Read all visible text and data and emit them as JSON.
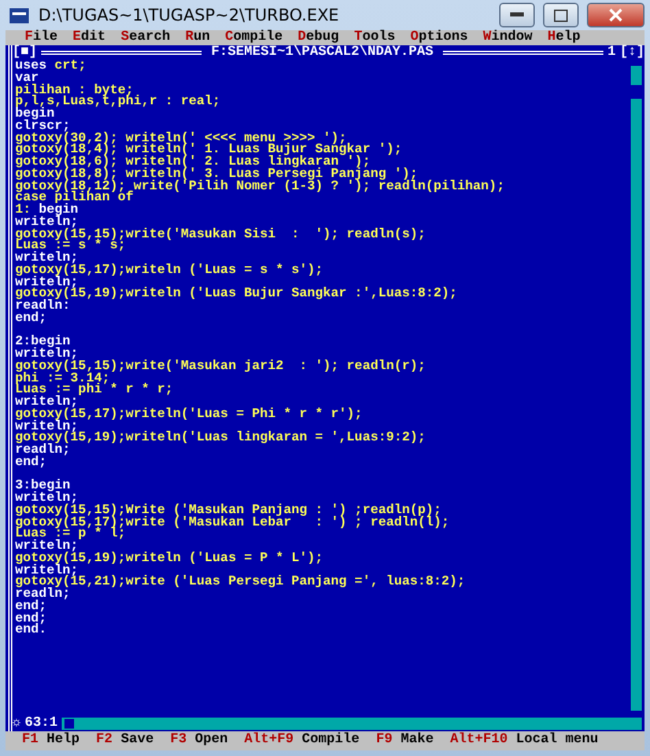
{
  "window": {
    "title": "D:\\TUGAS~1\\TUGASP~2\\TURBO.EXE"
  },
  "menu": [
    {
      "label": "File"
    },
    {
      "label": "Edit"
    },
    {
      "label": "Search"
    },
    {
      "label": "Run"
    },
    {
      "label": "Compile"
    },
    {
      "label": "Debug"
    },
    {
      "label": "Tools"
    },
    {
      "label": "Options"
    },
    {
      "label": "Window"
    },
    {
      "label": "Help"
    }
  ],
  "editor": {
    "close_box": "[■]",
    "file_path": "F:SEMESI~1\\PASCAL2\\NDAY.PAS",
    "window_number": "1",
    "zoom_box": "[↕]",
    "modified_mark": "☼",
    "cursor_position": "63:1",
    "lines": [
      {
        "parts": [
          {
            "text": "uses ",
            "kind": "keyword"
          },
          {
            "text": "crt;",
            "kind": "plain"
          }
        ]
      },
      {
        "parts": [
          {
            "text": "var",
            "kind": "keyword"
          }
        ]
      },
      {
        "parts": [
          {
            "text": "pilihan : byte;",
            "kind": "plain"
          }
        ]
      },
      {
        "parts": [
          {
            "text": "p,l,s,Luas,t,phi,r : real;",
            "kind": "plain"
          }
        ]
      },
      {
        "parts": [
          {
            "text": "begin",
            "kind": "keyword"
          }
        ]
      },
      {
        "parts": [
          {
            "text": "clrscr;",
            "kind": "keyword"
          }
        ]
      },
      {
        "parts": [
          {
            "text": "gotoxy(30,2); writeln(' <<<< menu >>>> ');",
            "kind": "plain"
          }
        ]
      },
      {
        "parts": [
          {
            "text": "gotoxy(18,4); writeln(' 1. Luas Bujur Sangkar ');",
            "kind": "plain"
          }
        ]
      },
      {
        "parts": [
          {
            "text": "gotoxy(18,6); writeln(' 2. Luas lingkaran ');",
            "kind": "plain"
          }
        ]
      },
      {
        "parts": [
          {
            "text": "gotoxy(18,8); writeln(' 3. Luas Persegi Panjang ');",
            "kind": "plain"
          }
        ]
      },
      {
        "parts": [
          {
            "text": "gotoxy(18,12); write('Pilih Nomer (1-3) ? '); readln(pilihan);",
            "kind": "plain"
          }
        ]
      },
      {
        "parts": [
          {
            "text": "case pilihan of",
            "kind": "plain"
          }
        ]
      },
      {
        "parts": [
          {
            "text": "1: ",
            "kind": "plain"
          },
          {
            "text": "begin",
            "kind": "keyword"
          }
        ]
      },
      {
        "parts": [
          {
            "text": "writeln;",
            "kind": "keyword"
          }
        ]
      },
      {
        "parts": [
          {
            "text": "gotoxy(15,15);write('Masukan Sisi  :  '); readln(s);",
            "kind": "plain"
          }
        ]
      },
      {
        "parts": [
          {
            "text": "Luas := s * s;",
            "kind": "plain"
          }
        ]
      },
      {
        "parts": [
          {
            "text": "writeln;",
            "kind": "keyword"
          }
        ]
      },
      {
        "parts": [
          {
            "text": "gotoxy(15,17);writeln ('Luas = s * s');",
            "kind": "plain"
          }
        ]
      },
      {
        "parts": [
          {
            "text": "writeln;",
            "kind": "keyword"
          }
        ]
      },
      {
        "parts": [
          {
            "text": "gotoxy(15,19);writeln ('Luas Bujur Sangkar :',Luas:8:2);",
            "kind": "plain"
          }
        ]
      },
      {
        "parts": [
          {
            "text": "readln:",
            "kind": "keyword"
          }
        ]
      },
      {
        "parts": [
          {
            "text": "end;",
            "kind": "keyword"
          }
        ]
      },
      {
        "space_before": true,
        "parts": [
          {
            "text": "2:begin",
            "kind": "keyword"
          }
        ]
      },
      {
        "parts": [
          {
            "text": "writeln;",
            "kind": "keyword"
          }
        ]
      },
      {
        "parts": [
          {
            "text": "gotoxy(15,15);write('Masukan jari2  : '); readln(r);",
            "kind": "plain"
          }
        ]
      },
      {
        "parts": [
          {
            "text": "phi := 3.14;",
            "kind": "plain"
          }
        ]
      },
      {
        "parts": [
          {
            "text": "Luas := phi * r * r;",
            "kind": "plain"
          }
        ]
      },
      {
        "parts": [
          {
            "text": "writeln;",
            "kind": "keyword"
          }
        ]
      },
      {
        "parts": [
          {
            "text": "gotoxy(15,17);writeln('Luas = Phi * r * r');",
            "kind": "plain"
          }
        ]
      },
      {
        "parts": [
          {
            "text": "writeln;",
            "kind": "keyword"
          }
        ]
      },
      {
        "parts": [
          {
            "text": "gotoxy(15,19);writeln('Luas lingkaran = ',Luas:9:2);",
            "kind": "plain"
          }
        ]
      },
      {
        "parts": [
          {
            "text": "readln;",
            "kind": "keyword"
          }
        ]
      },
      {
        "parts": [
          {
            "text": "end;",
            "kind": "keyword"
          }
        ]
      },
      {
        "space_before": true,
        "parts": [
          {
            "text": "3:begin",
            "kind": "keyword"
          }
        ]
      },
      {
        "parts": [
          {
            "text": "writeln;",
            "kind": "keyword"
          }
        ]
      },
      {
        "parts": [
          {
            "text": "gotoxy(15,15);Write ('Masukan Panjang : ') ;readln(p);",
            "kind": "plain"
          }
        ]
      },
      {
        "parts": [
          {
            "text": "gotoxy(15,17);write ('Masukan Lebar   : ') ; readln(l);",
            "kind": "plain"
          }
        ]
      },
      {
        "parts": [
          {
            "text": "Luas := p * l;",
            "kind": "plain"
          }
        ]
      },
      {
        "parts": [
          {
            "text": "writeln;",
            "kind": "keyword"
          }
        ]
      },
      {
        "parts": [
          {
            "text": "gotoxy(15,19);writeln ('Luas = P * L');",
            "kind": "plain"
          }
        ]
      },
      {
        "parts": [
          {
            "text": "writeln;",
            "kind": "keyword"
          }
        ]
      },
      {
        "parts": [
          {
            "text": "gotoxy(15,21);write ('Luas Persegi Panjang =', luas:8:2);",
            "kind": "plain"
          }
        ]
      },
      {
        "parts": [
          {
            "text": "readln;",
            "kind": "keyword"
          }
        ]
      },
      {
        "parts": [
          {
            "text": "end;",
            "kind": "keyword"
          }
        ]
      },
      {
        "parts": [
          {
            "text": "end;",
            "kind": "keyword"
          }
        ]
      },
      {
        "parts": [
          {
            "text": "end.",
            "kind": "keyword"
          }
        ]
      }
    ]
  },
  "status_bar": [
    {
      "key": "F1",
      "label": "Help"
    },
    {
      "key": "F2",
      "label": "Save"
    },
    {
      "key": "F3",
      "label": "Open"
    },
    {
      "key": "Alt+F9",
      "label": "Compile"
    },
    {
      "key": "F9",
      "label": "Make"
    },
    {
      "key": "Alt+F10",
      "label": "Local menu"
    }
  ]
}
